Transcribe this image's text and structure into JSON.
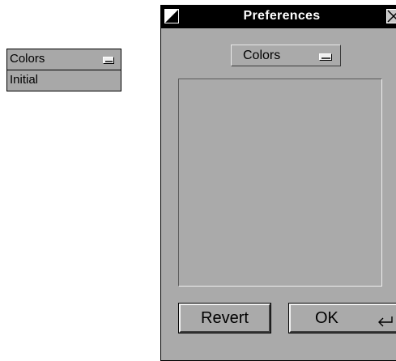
{
  "popup": {
    "selected": "Colors",
    "items": [
      "Initial"
    ]
  },
  "window": {
    "title": "Preferences",
    "category_value": "Colors",
    "buttons": {
      "revert": "Revert",
      "ok": "OK"
    }
  },
  "icons": {
    "popup_indicator": "option-menu-indicator-icon",
    "close": "close-icon",
    "menu": "window-menu-icon",
    "enter": "enter-key-icon"
  }
}
